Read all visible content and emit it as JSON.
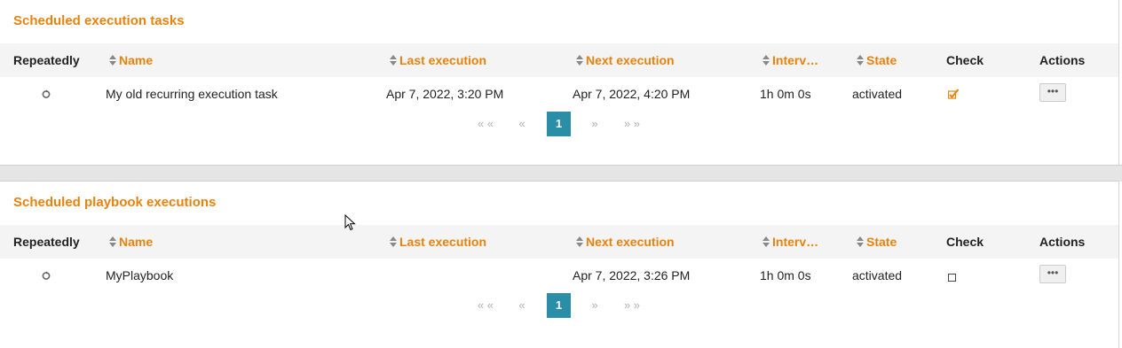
{
  "columns": {
    "repeatedly": "Repeatedly",
    "name": "Name",
    "last_execution": "Last execution",
    "next_execution": "Next execution",
    "interval": "Interv…",
    "state": "State",
    "check": "Check",
    "actions": "Actions"
  },
  "panels": [
    {
      "title": "Scheduled execution tasks",
      "row": {
        "name": "My old recurring execution task",
        "last_execution": "Apr 7, 2022, 3:20 PM",
        "next_execution": "Apr 7, 2022, 4:20 PM",
        "interval": "1h 0m 0s",
        "state": "activated",
        "checked": true,
        "actions_label": "•••"
      },
      "pager": {
        "first": "« «",
        "prev": "«",
        "current": "1",
        "next": "»",
        "last": "» »"
      }
    },
    {
      "title": "Scheduled playbook executions",
      "row": {
        "name": "MyPlaybook",
        "last_execution": "",
        "next_execution": "Apr 7, 2022, 3:26 PM",
        "interval": "1h 0m 0s",
        "state": "activated",
        "checked": false,
        "actions_label": "•••"
      },
      "pager": {
        "first": "« «",
        "prev": "«",
        "current": "1",
        "next": "»",
        "last": "» »"
      }
    }
  ],
  "icons": {
    "repeat": "repeat-icon",
    "checked": "checked-checkbox-icon",
    "unchecked": "unchecked-checkbox-icon",
    "sort": "sort-icon",
    "cursor": "mouse-cursor-icon"
  },
  "colors": {
    "accent": "#e8820c",
    "pager_active": "#2a8fa6",
    "header_bg": "#f4f4f4"
  }
}
